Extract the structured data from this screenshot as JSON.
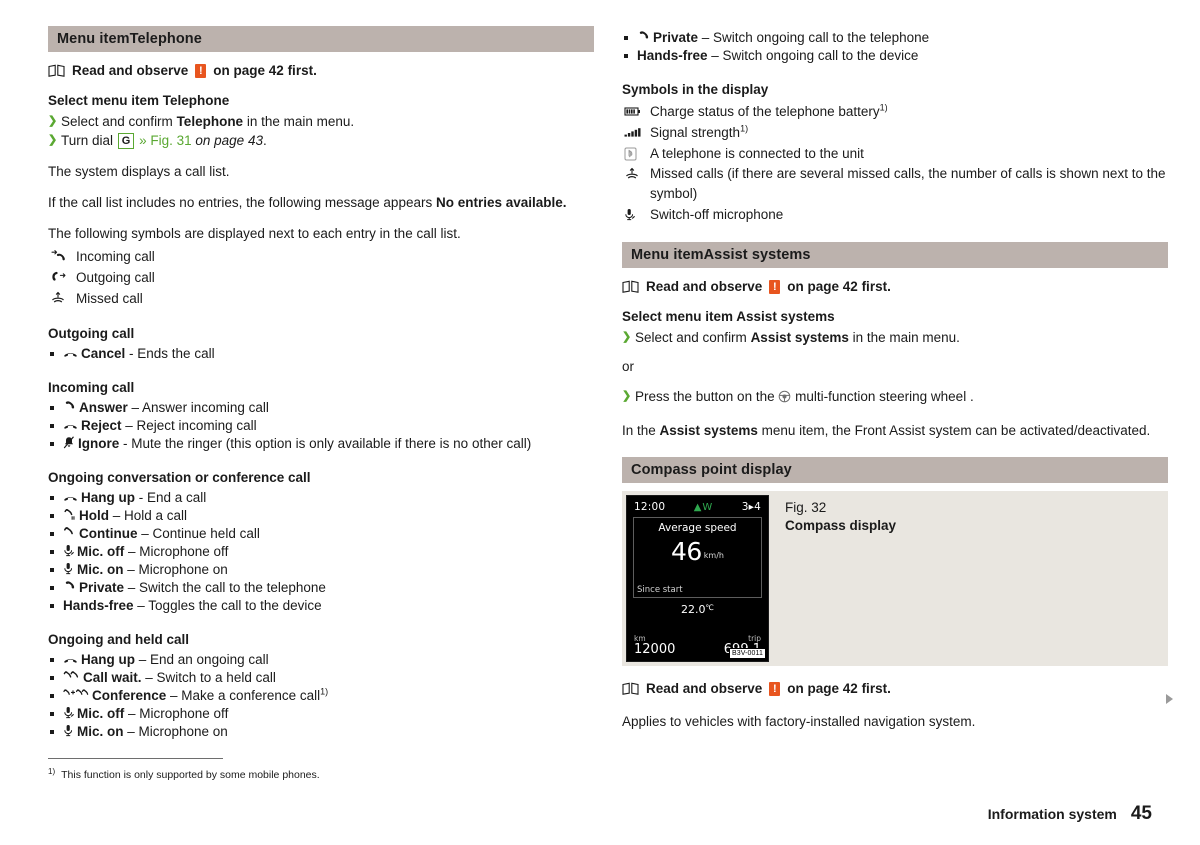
{
  "document": {
    "footer_label": "Information system",
    "page_number": "45"
  },
  "left_column": {
    "section": {
      "prefix": "Menu item",
      "name": "Telephone",
      "title": "Menu itemTelephone"
    },
    "note": {
      "pre": "Read and observe",
      "warn_glyph": "!",
      "post": "on page 42 first.",
      "book_icon": "book-icon"
    },
    "select_heading": "Select menu item Telephone",
    "steps": [
      {
        "text_before": "Select and confirm ",
        "bold": "Telephone",
        "text_after": " in the main menu."
      },
      {
        "text_before": "Turn dial ",
        "key": "G",
        "xref": "» Fig. 31",
        "italic": " on page 43",
        "text_after": "."
      }
    ],
    "paragraphs": {
      "call_list": "The system displays a call list.",
      "no_entries_pre": "If the call list includes no entries, the following message appears ",
      "no_entries_bold": "No entries available.",
      "symbols_intro": "The following symbols are displayed next to each entry in the call list."
    },
    "call_symbols": [
      {
        "icon": "incoming-call-icon",
        "label": "Incoming call"
      },
      {
        "icon": "outgoing-call-icon",
        "label": "Outgoing call"
      },
      {
        "icon": "missed-call-icon",
        "label": "Missed call"
      }
    ],
    "groups": [
      {
        "heading": "Outgoing call",
        "items": [
          {
            "icon": "hangup-icon",
            "bold": "Cancel",
            "rest": " - Ends the call"
          }
        ]
      },
      {
        "heading": "Incoming call",
        "items": [
          {
            "icon": "handset-icon",
            "bold": "Answer",
            "rest": " – Answer incoming call"
          },
          {
            "icon": "hangup-icon",
            "bold": "Reject",
            "rest": " – Reject incoming call"
          },
          {
            "icon": "mute-ringer-icon",
            "bold": "Ignore",
            "rest": " - Mute the ringer (this option is only available if there is no other call)"
          }
        ]
      },
      {
        "heading": "Ongoing conversation or conference call",
        "items": [
          {
            "icon": "hangup-icon",
            "bold": "Hang up",
            "rest": " - End a call"
          },
          {
            "icon": "hold-icon",
            "bold": "Hold",
            "rest": " – Hold a call"
          },
          {
            "icon": "continue-icon",
            "bold": "Continue",
            "rest": " – Continue held call"
          },
          {
            "icon": "mic-off-icon",
            "bold": "Mic. off",
            "rest": " – Microphone off"
          },
          {
            "icon": "mic-on-icon",
            "bold": "Mic. on",
            "rest": " – Microphone on"
          },
          {
            "icon": "handset-icon",
            "bold": "Private",
            "rest": " – Switch the call to the telephone"
          },
          {
            "icon": "none",
            "bold": "Hands-free",
            "rest": " – Toggles the call to the device"
          }
        ]
      },
      {
        "heading": "Ongoing and held call",
        "items": [
          {
            "icon": "hangup-icon",
            "bold": "Hang up",
            "rest": " – End an ongoing call"
          },
          {
            "icon": "call-wait-icon",
            "bold": "Call wait.",
            "rest": " – Switch to a held call"
          },
          {
            "icon": "conference-icon",
            "bold": "Conference",
            "rest": " – Make a conference call",
            "footnote": "1)"
          },
          {
            "icon": "mic-off-icon",
            "bold": "Mic. off",
            "rest": " – Microphone off"
          },
          {
            "icon": "mic-on-icon",
            "bold": "Mic. on",
            "rest": " – Microphone on"
          }
        ]
      }
    ]
  },
  "right_column": {
    "top_items": [
      {
        "icon": "handset-icon",
        "bold": "Private",
        "rest": " – Switch ongoing call to the telephone"
      },
      {
        "icon": "none",
        "bold": "Hands-free",
        "rest": " – Switch ongoing call to the device"
      }
    ],
    "display_symbols_heading": "Symbols in the display",
    "display_symbols": [
      {
        "icon": "battery-icon",
        "label": "Charge status of the telephone battery",
        "footnote": "1)"
      },
      {
        "icon": "signal-strength-icon",
        "label": "Signal strength",
        "footnote": "1)"
      },
      {
        "icon": "bluetooth-icon",
        "label": "A telephone is connected to the unit",
        "footnote": ""
      },
      {
        "icon": "missed-call-icon",
        "label": "Missed calls (if there are several missed calls, the number of calls is shown next to the symbol)",
        "footnote": ""
      },
      {
        "icon": "mic-off-icon",
        "label": "Switch-off microphone",
        "footnote": ""
      }
    ],
    "assist_section": {
      "title": "Menu itemAssist systems",
      "note": {
        "pre": "Read and observe",
        "warn_glyph": "!",
        "post": "on page 42 first."
      },
      "select_heading": "Select menu item Assist systems",
      "step1_before": "Select and confirm ",
      "step1_bold": "Assist systems",
      "step1_after": " in the main menu.",
      "or": "or",
      "step2_before": "Press the button on the ",
      "step2_icon": "steering-wheel-icon",
      "step2_after": " multi-function steering wheel .",
      "body_pre": "In the ",
      "body_bold": "Assist systems",
      "body_post": " menu item, the Front Assist system can be activated/deactivated."
    },
    "compass_section": {
      "title": "Compass point display",
      "figure": {
        "caption_line1": "Fig. 32",
        "caption_line2": "Compass display",
        "image_code": "B3V-0011",
        "display": {
          "clock": "12:00",
          "compass": "W",
          "gear": "3▸4",
          "panel_title": "Average speed",
          "value": "46",
          "unit": "km/h",
          "since": "Since start",
          "temperature": "22.0",
          "temperature_unit": "℃",
          "odometer_label": "km",
          "odometer_value": "12000",
          "trip_label": "trip",
          "trip_value": "699.1"
        }
      },
      "note": {
        "pre": "Read and observe",
        "warn_glyph": "!",
        "post": "on page 42 first."
      },
      "applies": "Applies to vehicles with factory-installed navigation system."
    }
  },
  "footnote": {
    "marker": "1)",
    "text": "This function is only supported by some mobile phones."
  },
  "colors": {
    "section_bar": "#bcb2ad",
    "accent_green": "#5aa832",
    "warn_orange": "#e8551f",
    "figure_bg": "#e9e6e0"
  }
}
